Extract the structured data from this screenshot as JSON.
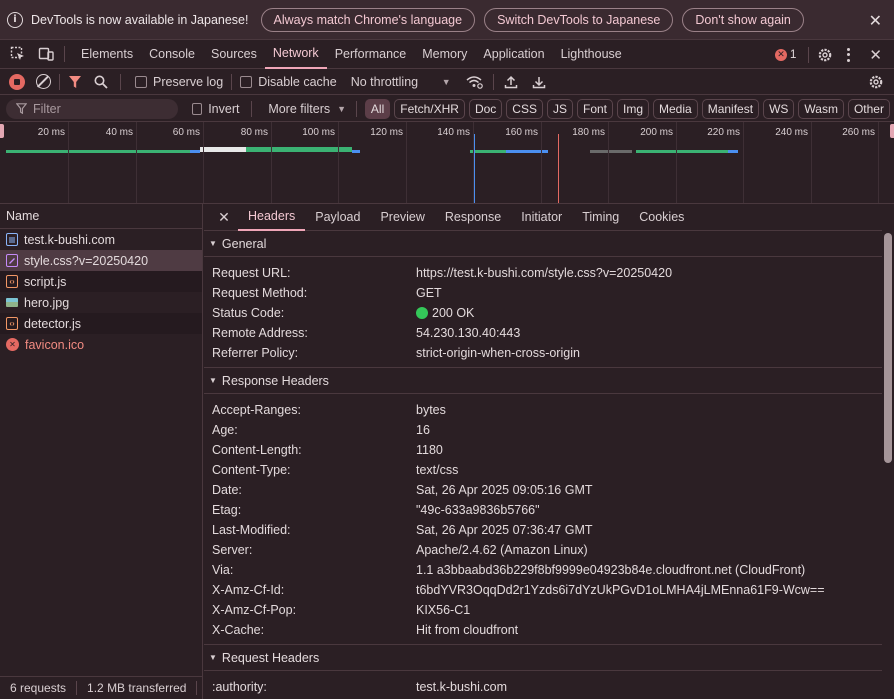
{
  "infobar": {
    "message": "DevTools is now available in Japanese!",
    "buttons": [
      "Always match Chrome's language",
      "Switch DevTools to Japanese",
      "Don't show again"
    ]
  },
  "main_tabs": [
    "Elements",
    "Console",
    "Sources",
    "Network",
    "Performance",
    "Memory",
    "Application",
    "Lighthouse"
  ],
  "active_main_tab": "Network",
  "error_count": "1",
  "toolbar": {
    "preserve_log": "Preserve log",
    "disable_cache": "Disable cache",
    "throttling": "No throttling"
  },
  "filter": {
    "placeholder": "Filter",
    "invert": "Invert",
    "more_filters": "More filters",
    "types": [
      "All",
      "Fetch/XHR",
      "Doc",
      "CSS",
      "JS",
      "Font",
      "Img",
      "Media",
      "Manifest",
      "WS",
      "Wasm",
      "Other"
    ]
  },
  "timeline": {
    "ticks": [
      "20 ms",
      "40 ms",
      "60 ms",
      "80 ms",
      "100 ms",
      "120 ms",
      "140 ms",
      "160 ms",
      "180 ms",
      "200 ms",
      "220 ms",
      "240 ms",
      "260 ms"
    ]
  },
  "request_list": {
    "header": "Name",
    "rows": [
      {
        "name": "test.k-bushi.com",
        "type": "doc"
      },
      {
        "name": "style.css?v=20250420",
        "type": "css",
        "selected": true
      },
      {
        "name": "script.js",
        "type": "js"
      },
      {
        "name": "hero.jpg",
        "type": "img"
      },
      {
        "name": "detector.js",
        "type": "js"
      },
      {
        "name": "favicon.ico",
        "type": "error"
      }
    ]
  },
  "detail_tabs": [
    "Headers",
    "Payload",
    "Preview",
    "Response",
    "Initiator",
    "Timing",
    "Cookies"
  ],
  "active_detail_tab": "Headers",
  "general": {
    "title": "General",
    "rows": [
      {
        "k": "Request URL:",
        "v": "https://test.k-bushi.com/style.css?v=20250420"
      },
      {
        "k": "Request Method:",
        "v": "GET"
      },
      {
        "k": "Status Code:",
        "v": "200 OK"
      },
      {
        "k": "Remote Address:",
        "v": "54.230.130.40:443"
      },
      {
        "k": "Referrer Policy:",
        "v": "strict-origin-when-cross-origin"
      }
    ]
  },
  "response_headers": {
    "title": "Response Headers",
    "rows": [
      {
        "k": "Accept-Ranges:",
        "v": "bytes"
      },
      {
        "k": "Age:",
        "v": "16"
      },
      {
        "k": "Content-Length:",
        "v": "1180"
      },
      {
        "k": "Content-Type:",
        "v": "text/css"
      },
      {
        "k": "Date:",
        "v": "Sat, 26 Apr 2025 09:05:16 GMT"
      },
      {
        "k": "Etag:",
        "v": "\"49c-633a9836b5766\""
      },
      {
        "k": "Last-Modified:",
        "v": "Sat, 26 Apr 2025 07:36:47 GMT"
      },
      {
        "k": "Server:",
        "v": "Apache/2.4.62 (Amazon Linux)"
      },
      {
        "k": "Via:",
        "v": "1.1 a3bbaabd36b229f8bf9999e04923b84e.cloudfront.net (CloudFront)"
      },
      {
        "k": "X-Amz-Cf-Id:",
        "v": "t6bdYVR3OqqDd2r1Yzds6i7dYzUkPGvD1oLMHA4jLMEnna61F9-Wcw=="
      },
      {
        "k": "X-Amz-Cf-Pop:",
        "v": "KIX56-C1"
      },
      {
        "k": "X-Cache:",
        "v": "Hit from cloudfront"
      }
    ]
  },
  "request_headers": {
    "title": "Request Headers",
    "rows": [
      {
        "k": ":authority:",
        "v": "test.k-bushi.com"
      }
    ]
  },
  "statusbar": {
    "requests": "6 requests",
    "transferred": "1.2 MB transferred"
  },
  "colors": {
    "accent": "#f0a6b8",
    "error": "#e46962",
    "ok": "#34c759"
  }
}
